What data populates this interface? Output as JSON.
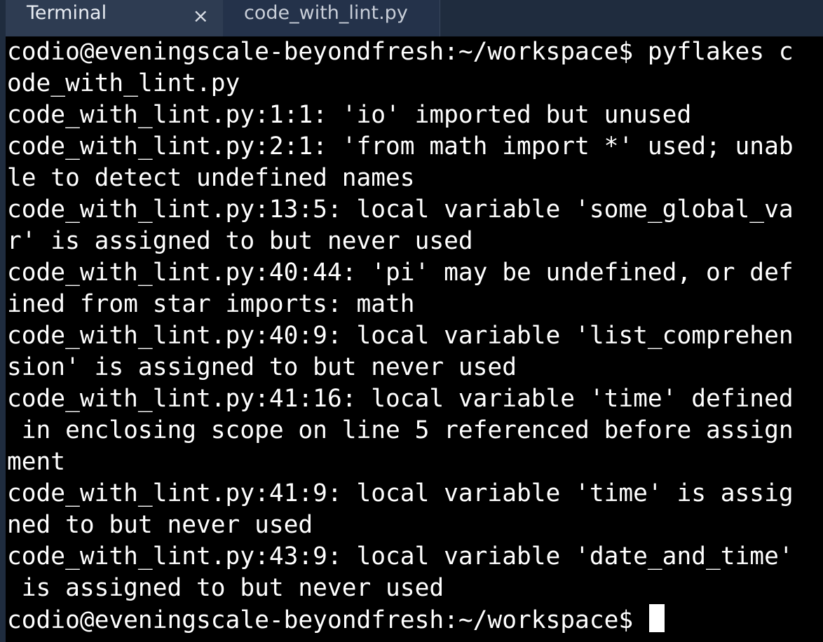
{
  "tabs": {
    "terminal_label": "Terminal",
    "close_glyph": "×",
    "file_label": "code_with_lint.py"
  },
  "terminal": {
    "lines": [
      "codio@eveningscale-beyondfresh:~/workspace$ pyflakes c",
      "ode_with_lint.py",
      "code_with_lint.py:1:1: 'io' imported but unused",
      "code_with_lint.py:2:1: 'from math import *' used; unab",
      "le to detect undefined names",
      "code_with_lint.py:13:5: local variable 'some_global_va",
      "r' is assigned to but never used",
      "code_with_lint.py:40:44: 'pi' may be undefined, or def",
      "ined from star imports: math",
      "code_with_lint.py:40:9: local variable 'list_comprehen",
      "sion' is assigned to but never used",
      "code_with_lint.py:41:16: local variable 'time' defined",
      " in enclosing scope on line 5 referenced before assign",
      "ment",
      "code_with_lint.py:41:9: local variable 'time' is assig",
      "ned to but never used",
      "code_with_lint.py:43:9: local variable 'date_and_time'",
      " is assigned to but never used"
    ],
    "prompt": "codio@eveningscale-beyondfresh:~/workspace$ "
  },
  "colors": {
    "background": "#000000",
    "text": "#ffffff",
    "tabbar": "#1f2c3e",
    "active_tab": "#2e3c52"
  },
  "icons": {
    "close": "close-icon"
  }
}
